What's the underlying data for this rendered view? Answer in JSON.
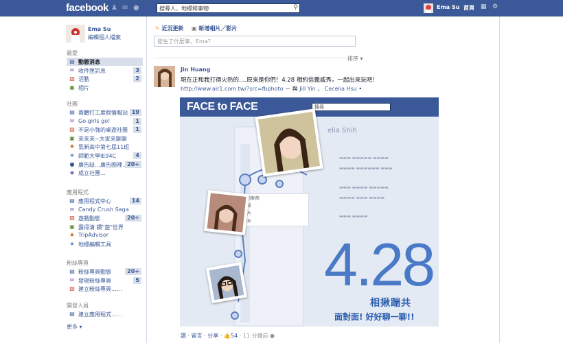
{
  "topbar": {
    "logo": "facebook",
    "search_placeholder": "搜尋人、地標和事物",
    "user_name": "Ema Su",
    "home": "首頁"
  },
  "profile": {
    "name": "Ema Su",
    "edit": "編輯個人檔案"
  },
  "sections": {
    "favorites": "最愛",
    "groups": "社團",
    "apps": "應用程式",
    "pages": "粉絲專頁",
    "developer": "開發人員",
    "more": "更多"
  },
  "favorites": [
    {
      "label": "動態消息",
      "count": ""
    },
    {
      "label": "收件匣訊息",
      "count": "3"
    },
    {
      "label": "活動",
      "count": "2"
    },
    {
      "label": "相片",
      "count": ""
    }
  ],
  "groups": [
    {
      "label": "兩體打工度假情報站",
      "count": "19"
    },
    {
      "label": "Go girls go!",
      "count": "1"
    },
    {
      "label": "不是小強的桌遊社團",
      "count": "1"
    },
    {
      "label": "來來來~大家來聊聊",
      "count": ""
    },
    {
      "label": "氫新高中第七屆11班",
      "count": ""
    },
    {
      "label": "師範大學IE94C",
      "count": "4"
    },
    {
      "label": "廣告缺…廣告圈裡…",
      "count": "20+"
    },
    {
      "label": "成立社團…",
      "count": ""
    }
  ],
  "apps": [
    {
      "label": "應用程式中心",
      "count": "14"
    },
    {
      "label": "Candy Crush Saga",
      "count": ""
    },
    {
      "label": "遊戲動態",
      "count": "20+"
    },
    {
      "label": "露得清 鑽\"遊\"世界",
      "count": ""
    },
    {
      "label": "TripAdvisor",
      "count": ""
    },
    {
      "label": "地標編輯工具",
      "count": ""
    }
  ],
  "pages": [
    {
      "label": "粉絲專頁動態",
      "count": "20+"
    },
    {
      "label": "發現粉絲專頁",
      "count": "5"
    },
    {
      "label": "建立粉絲專頁……",
      "count": ""
    }
  ],
  "developer": [
    {
      "label": "建立應用程式……",
      "count": ""
    }
  ],
  "composer": {
    "tab1": "近況更新",
    "tab2": "新增相片／影片",
    "placeholder": "發生了什麼事，Ema？",
    "sort": "排序"
  },
  "post": {
    "author": "Jin Huang",
    "text": "現在正和我打得火熱的….原來是你們！4.28 相約信義威秀，一起出來玩吧！",
    "link": "http://www.air1.com.tw/?src=fbphoto",
    "with": "－ 與",
    "tag1": "Jill Yin",
    "sep": "、",
    "tag2": "Cecelia Hsu",
    "photo": {
      "title": "FACE to FACE",
      "search": "搜尋",
      "name": "elia Shih",
      "big": "4.28",
      "sub1": "相揪踹共",
      "sub2": "面對面! 好好聊一聊!!",
      "menu": [
        "近況動態",
        "資訊",
        "相片",
        "朋友"
      ]
    },
    "footer": {
      "like": "讚",
      "comment": "留言",
      "share": "分享",
      "likes": "54",
      "time": "11 分鐘前"
    }
  }
}
